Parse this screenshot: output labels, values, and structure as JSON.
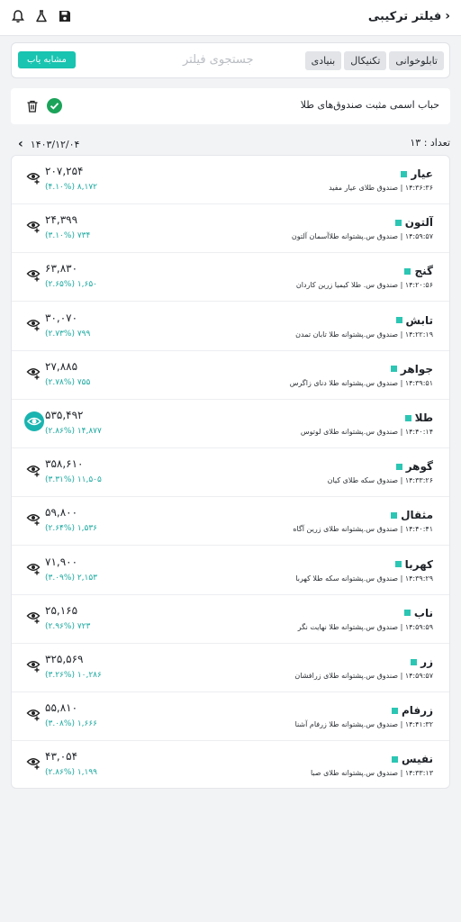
{
  "header": {
    "title": "فیلتر ترکیبی",
    "icons": [
      "bell-icon",
      "flask-icon",
      "save-icon",
      "back-chevron-icon"
    ]
  },
  "search": {
    "tabs": [
      "تابلوخوانی",
      "تکنیکال",
      "بنیادی"
    ],
    "placeholder": "جستجوی فیلتر",
    "similar_label": "مشابه یاب"
  },
  "filter": {
    "name": "حباب اسمی مثبت صندوق‌های طلا"
  },
  "summary": {
    "count_label": "تعداد : ۱۳",
    "date": "۱۴۰۳/۱۲/۰۴"
  },
  "colors": {
    "accent": "#19c4b0",
    "check": "#1ba35a",
    "change_text": "#1aa9a0"
  },
  "items": [
    {
      "name": "عیار",
      "time": "۱۴:۳۶:۳۶",
      "fund": "صندوق طلای عیار مفید",
      "value": "۲۰۷,۲۵۴",
      "change": "۸,۱۷۲ (۴.۱۰%)",
      "active": false
    },
    {
      "name": "آلتون",
      "time": "۱۴:۵۹:۵۷",
      "fund": "صندوق س.پشتوانه طلاآسمان آلتون",
      "value": "۲۴,۳۹۹",
      "change": "۷۳۴ (۳.۱۰%)",
      "active": false
    },
    {
      "name": "گنج",
      "time": "۱۴:۲۰:۵۶",
      "fund": "صندوق س. طلا کیمیا زرین کاردان",
      "value": "۶۳,۸۳۰",
      "change": "۱,۶۵۰ (۲.۶۵%)",
      "active": false
    },
    {
      "name": "تابش",
      "time": "۱۴:۲۲:۱۹",
      "fund": "صندوق س.پشتوانه طلا تابان تمدن",
      "value": "۳۰,۰۷۰",
      "change": "۷۹۹ (۲.۷۳%)",
      "active": false
    },
    {
      "name": "جواهر",
      "time": "۱۴:۳۹:۵۱",
      "fund": "صندوق س.پشتوانه طلا دنای زاگرس",
      "value": "۲۷,۸۸۵",
      "change": "۷۵۵ (۲.۷۸%)",
      "active": false
    },
    {
      "name": "طلا",
      "time": "۱۴:۴۰:۱۴",
      "fund": "صندوق س.پشتوانه طلای لوتوس",
      "value": "۵۳۵,۴۹۲",
      "change": "۱۴,۸۷۷ (۲.۸۶%)",
      "active": true
    },
    {
      "name": "گوهر",
      "time": "۱۴:۳۳:۲۶",
      "fund": "صندوق سکه طلای کیان",
      "value": "۳۵۸,۶۱۰",
      "change": "۱۱,۵۰۵ (۳.۳۱%)",
      "active": false
    },
    {
      "name": "مثقال",
      "time": "۱۴:۴۰:۴۱",
      "fund": "صندوق س.پشتوانه طلای زرین آگاه",
      "value": "۵۹,۸۰۰",
      "change": "۱,۵۳۶ (۲.۶۴%)",
      "active": false
    },
    {
      "name": "کهربا",
      "time": "۱۴:۳۹:۲۹",
      "fund": "صندوق س.پشتوانه سکه طلا کهربا",
      "value": "۷۱,۹۰۰",
      "change": "۲,۱۵۳ (۳.۰۹%)",
      "active": false
    },
    {
      "name": "ناب",
      "time": "۱۴:۵۹:۵۹",
      "fund": "صندوق س.پشتوانه طلا نهایت نگر",
      "value": "۲۵,۱۶۵",
      "change": "۷۲۳ (۲.۹۶%)",
      "active": false
    },
    {
      "name": "زر",
      "time": "۱۴:۵۹:۵۷",
      "fund": "صندوق س.پشتوانه طلای زرافشان",
      "value": "۳۲۵,۵۶۹",
      "change": "۱۰,۲۸۶ (۳.۲۶%)",
      "active": false
    },
    {
      "name": "زرفام",
      "time": "۱۴:۴۱:۳۲",
      "fund": "صندوق س.پشتوانه طلا زرفام آشنا",
      "value": "۵۵,۸۱۰",
      "change": "۱,۶۶۶ (۳.۰۸%)",
      "active": false
    },
    {
      "name": "نفیس",
      "time": "۱۴:۳۳:۱۳",
      "fund": "صندوق س.پشتوانه طلای صبا",
      "value": "۴۳,۰۵۴",
      "change": "۱,۱۹۹ (۲.۸۶%)",
      "active": false
    }
  ]
}
